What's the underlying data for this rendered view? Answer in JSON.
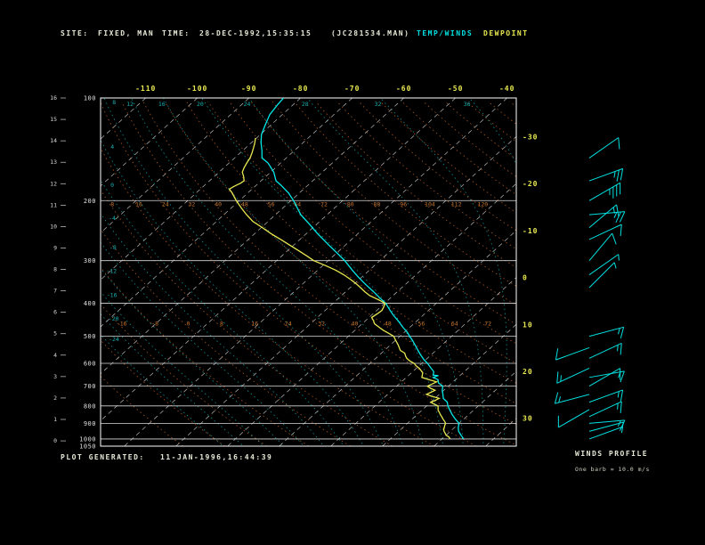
{
  "header": {
    "site_label": "SITE:",
    "site_value": "FIXED, MAN",
    "time_label": "TIME:",
    "time_value": "28-DEC-1992,15:35:15",
    "file_id": "(JC281534.MAN)",
    "legend_temp": "TEMP/WINDS",
    "legend_dew": "DEWPOINT"
  },
  "footer": {
    "label": "PLOT GENERATED:",
    "value": "11-JAN-1996,16:44:39"
  },
  "winds_panel": {
    "title": "WINDS PROFILE",
    "legend": "One barb = 10.0 m/s"
  },
  "colors": {
    "background": "#000000",
    "frame": "#ffffff",
    "isobar": "#d8d8d8",
    "isotherm": "#b8b8b8",
    "dry_adiabat": "#a85520",
    "dry_adiabat_label": "#c87830",
    "moist_adiabat": "#0d9090",
    "moist_adiabat_label": "#18b0b0",
    "temp_trace": "#00e8e8",
    "dew_trace": "#e8e850",
    "tick_label_yellow": "#e8e850",
    "tick_label_white": "#e0e0e0",
    "wind": "#00e0e0"
  },
  "chart_data": {
    "type": "line",
    "title": "Skew-T log-P thermodynamic diagram",
    "x_axis": {
      "label": "Temperature (C)",
      "top_tick_labels": [
        -110,
        -100,
        -90,
        -80,
        -70,
        -60,
        -50,
        -40
      ],
      "right_tick_labels": [
        -30,
        -20,
        -10,
        0,
        10,
        20,
        30
      ]
    },
    "y_axis": {
      "label": "Pressure (hPa)",
      "scale": "log",
      "ticks": [
        100,
        200,
        300,
        400,
        500,
        600,
        700,
        800,
        900,
        1000,
        1050
      ],
      "ylim": [
        1050,
        100
      ]
    },
    "height_axis_km": [
      0,
      1,
      2,
      3,
      4,
      5,
      6,
      7,
      8,
      9,
      10,
      11,
      12,
      13,
      14,
      15,
      16
    ],
    "isotherms_c": [
      -120,
      -110,
      -100,
      -90,
      -80,
      -70,
      -60,
      -50,
      -40,
      -30,
      -20,
      -10,
      0,
      10,
      20,
      30,
      40
    ],
    "dry_adiabats_c": [
      -32,
      -24,
      -16,
      -8,
      0,
      8,
      16,
      24,
      32,
      40,
      48,
      56,
      64,
      72,
      80,
      88,
      96,
      104,
      112,
      120,
      128,
      136,
      144,
      152,
      160,
      168,
      176
    ],
    "moist_adiabats_c": [
      -24,
      -20,
      -16,
      -12,
      -8,
      -4,
      0,
      4,
      8,
      12,
      16,
      20,
      24,
      28,
      32,
      36,
      40
    ],
    "series": [
      {
        "name": "temperature",
        "color": "#00e8e8",
        "points": [
          [
            1000,
            24.2
          ],
          [
            975,
            22.9
          ],
          [
            950,
            21.6
          ],
          [
            925,
            20.7
          ],
          [
            900,
            20.0
          ],
          [
            875,
            18.4
          ],
          [
            850,
            16.9
          ],
          [
            825,
            15.5
          ],
          [
            800,
            14.1
          ],
          [
            780,
            13.2
          ],
          [
            760,
            11.6
          ],
          [
            740,
            10.7
          ],
          [
            720,
            9.7
          ],
          [
            700,
            8.9
          ],
          [
            685,
            7.4
          ],
          [
            670,
            6.6
          ],
          [
            660,
            5.2
          ],
          [
            652,
            5.8
          ],
          [
            650,
            4.7
          ],
          [
            635,
            4.1
          ],
          [
            620,
            2.8
          ],
          [
            600,
            1.1
          ],
          [
            585,
            -0.4
          ],
          [
            565,
            -2.2
          ],
          [
            550,
            -3.5
          ],
          [
            535,
            -4.8
          ],
          [
            515,
            -6.6
          ],
          [
            500,
            -8.1
          ],
          [
            485,
            -9.6
          ],
          [
            470,
            -11.4
          ],
          [
            455,
            -13.1
          ],
          [
            450,
            -13.7
          ],
          [
            435,
            -15.6
          ],
          [
            420,
            -17.4
          ],
          [
            400,
            -19.8
          ],
          [
            385,
            -22.2
          ],
          [
            370,
            -24.6
          ],
          [
            350,
            -28.1
          ],
          [
            335,
            -30.7
          ],
          [
            320,
            -33.3
          ],
          [
            300,
            -36.8
          ],
          [
            285,
            -39.9
          ],
          [
            270,
            -43.2
          ],
          [
            250,
            -47.8
          ],
          [
            235,
            -51.3
          ],
          [
            220,
            -55.1
          ],
          [
            200,
            -59.5
          ],
          [
            190,
            -62.1
          ],
          [
            180,
            -65.3
          ],
          [
            175,
            -67.1
          ],
          [
            165,
            -69.4
          ],
          [
            155,
            -72.5
          ],
          [
            150,
            -74.7
          ],
          [
            143,
            -76.2
          ],
          [
            135,
            -78.2
          ],
          [
            128,
            -79.8
          ],
          [
            120,
            -81.1
          ],
          [
            112,
            -82.4
          ],
          [
            105,
            -83.0
          ],
          [
            100,
            -83.3
          ]
        ]
      },
      {
        "name": "dewpoint",
        "color": "#e8e850",
        "points": [
          [
            1000,
            21.6
          ],
          [
            985,
            20.8
          ],
          [
            975,
            20.0
          ],
          [
            960,
            19.3
          ],
          [
            950,
            18.8
          ],
          [
            935,
            18.2
          ],
          [
            925,
            18.0
          ],
          [
            910,
            17.6
          ],
          [
            900,
            17.4
          ],
          [
            885,
            16.6
          ],
          [
            875,
            16.0
          ],
          [
            860,
            15.2
          ],
          [
            850,
            14.6
          ],
          [
            835,
            13.8
          ],
          [
            825,
            13.2
          ],
          [
            810,
            12.6
          ],
          [
            800,
            12.2
          ],
          [
            790,
            11.0
          ],
          [
            780,
            10.0
          ],
          [
            770,
            10.5
          ],
          [
            760,
            10.8
          ],
          [
            750,
            9.0
          ],
          [
            740,
            7.5
          ],
          [
            730,
            7.9
          ],
          [
            720,
            8.3
          ],
          [
            710,
            7.0
          ],
          [
            700,
            5.9
          ],
          [
            690,
            6.4
          ],
          [
            680,
            6.8
          ],
          [
            670,
            4.8
          ],
          [
            660,
            3.0
          ],
          [
            650,
            2.6
          ],
          [
            640,
            2.2
          ],
          [
            630,
            1.4
          ],
          [
            620,
            0.5
          ],
          [
            610,
            -0.6
          ],
          [
            600,
            -1.5
          ],
          [
            590,
            -2.9
          ],
          [
            580,
            -4.0
          ],
          [
            570,
            -4.8
          ],
          [
            560,
            -5.5
          ],
          [
            555,
            -6.2
          ],
          [
            550,
            -6.9
          ],
          [
            540,
            -7.7
          ],
          [
            530,
            -8.5
          ],
          [
            520,
            -9.4
          ],
          [
            510,
            -10.3
          ],
          [
            500,
            -11.2
          ],
          [
            490,
            -12.8
          ],
          [
            480,
            -14.5
          ],
          [
            470,
            -16.0
          ],
          [
            460,
            -17.5
          ],
          [
            455,
            -18.0
          ],
          [
            450,
            -18.4
          ],
          [
            445,
            -19.0
          ],
          [
            440,
            -19.5
          ],
          [
            430,
            -19.2
          ],
          [
            420,
            -19.0
          ],
          [
            410,
            -19.4
          ],
          [
            400,
            -19.9
          ],
          [
            390,
            -22.1
          ],
          [
            380,
            -24.5
          ],
          [
            370,
            -26.3
          ],
          [
            360,
            -28.0
          ],
          [
            350,
            -29.8
          ],
          [
            340,
            -31.8
          ],
          [
            330,
            -34.0
          ],
          [
            320,
            -36.5
          ],
          [
            310,
            -39.5
          ],
          [
            300,
            -42.8
          ],
          [
            290,
            -45.3
          ],
          [
            280,
            -48.0
          ],
          [
            270,
            -50.8
          ],
          [
            260,
            -53.7
          ],
          [
            250,
            -56.8
          ],
          [
            240,
            -59.8
          ],
          [
            230,
            -63.0
          ],
          [
            220,
            -65.6
          ],
          [
            210,
            -68.1
          ],
          [
            200,
            -70.6
          ],
          [
            195,
            -71.8
          ],
          [
            190,
            -73.0
          ],
          [
            185,
            -74.4
          ],
          [
            182,
            -74.1
          ],
          [
            180,
            -73.8
          ],
          [
            178,
            -73.5
          ],
          [
            175,
            -73.3
          ],
          [
            170,
            -74.3
          ],
          [
            165,
            -75.5
          ],
          [
            160,
            -76.1
          ],
          [
            155,
            -76.6
          ],
          [
            150,
            -77.0
          ],
          [
            145,
            -77.7
          ],
          [
            140,
            -78.5
          ],
          [
            136,
            -79.2
          ],
          [
            131,
            -80.2
          ]
        ]
      }
    ],
    "winds_barb_value_ms": 10.0,
    "winds": [
      [
        150,
        55,
        10
      ],
      [
        175,
        70,
        27
      ],
      [
        200,
        60,
        33
      ],
      [
        220,
        85,
        28
      ],
      [
        240,
        50,
        18
      ],
      [
        260,
        65,
        12
      ],
      [
        300,
        40,
        10
      ],
      [
        330,
        55,
        8
      ],
      [
        360,
        45,
        6
      ],
      [
        500,
        75,
        14
      ],
      [
        540,
        250,
        10
      ],
      [
        580,
        65,
        17
      ],
      [
        620,
        245,
        13
      ],
      [
        660,
        80,
        19
      ],
      [
        700,
        60,
        12
      ],
      [
        740,
        255,
        16
      ],
      [
        780,
        70,
        14
      ],
      [
        820,
        240,
        11
      ],
      [
        860,
        65,
        17
      ],
      [
        900,
        85,
        13
      ],
      [
        950,
        75,
        9
      ],
      [
        1000,
        70,
        6
      ]
    ]
  }
}
